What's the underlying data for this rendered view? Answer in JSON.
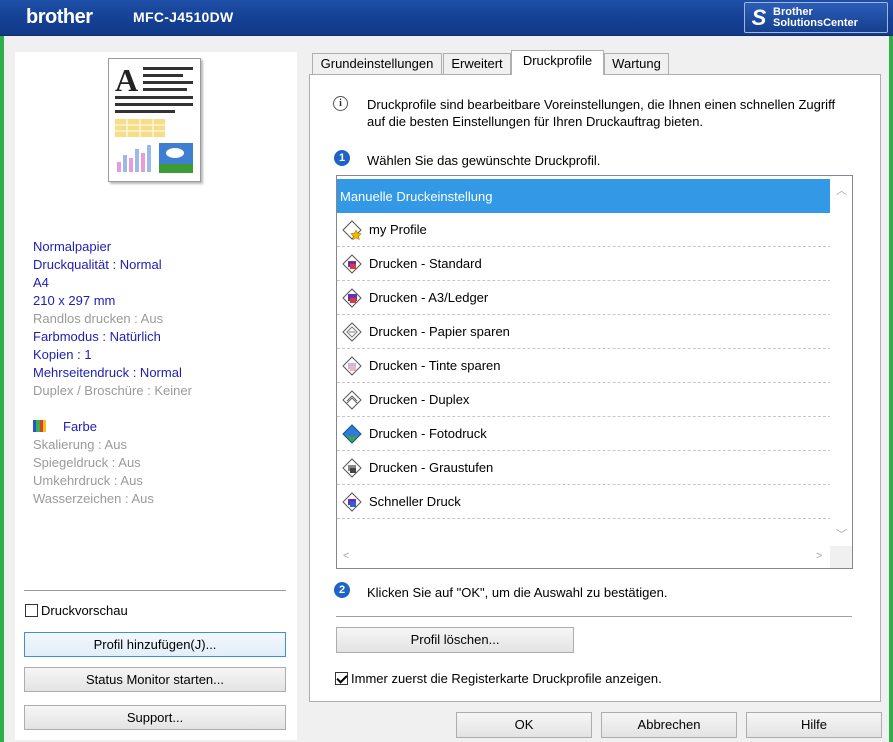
{
  "titlebar": {
    "brand": "brother",
    "model": "MFC-J4510DW",
    "solutions_line1": "Brother",
    "solutions_line2": "SolutionsCenter"
  },
  "summary": {
    "lines_on": [
      "Normalpapier",
      "Druckqualität : Normal",
      "A4",
      "210 x 297 mm"
    ],
    "randlos": "Randlos drucken : Aus",
    "farbmodus": "Farbmodus : Natürlich",
    "kopien": "Kopien : 1",
    "mehrseiten": "Mehrseitendruck : Normal",
    "duplex": "Duplex / Broschüre : Keiner",
    "farbe": "Farbe",
    "skalierung": "Skalierung : Aus",
    "spiegel": "Spiegeldruck : Aus",
    "umkehr": "Umkehrdruck : Aus",
    "wasser": "Wasserzeichen : Aus"
  },
  "left": {
    "preview_checkbox": "Druckvorschau",
    "preview_checked": false,
    "add_profile": "Profil hinzufügen(J)...",
    "status_monitor": "Status Monitor starten...",
    "support": "Support..."
  },
  "tabs": [
    "Grundeinstellungen",
    "Erweitert",
    "Druckprofile",
    "Wartung"
  ],
  "active_tab": "Druckprofile",
  "main": {
    "info_text_1": "Druckprofile sind bearbeitbare Voreinstellungen, die Ihnen einen schnellen Zugriff",
    "info_text_2": "auf die besten Einstellungen für Ihren Druckauftrag bieten.",
    "step1_num": "1",
    "step1": "Wählen Sie das gewünschte Druckprofil.",
    "profiles": [
      {
        "label": "Manuelle Druckeinstellung",
        "icon": "none",
        "selected": true
      },
      {
        "label": "my Profile",
        "icon": "star-profile-icon",
        "selected": false
      },
      {
        "label": "Drucken - Standard",
        "icon": "printer-profile-icon",
        "selected": false
      },
      {
        "label": "Drucken - A3/Ledger",
        "icon": "printer-profile-icon",
        "selected": false
      },
      {
        "label": "Drucken - Papier sparen",
        "icon": "paper-save-icon",
        "selected": false
      },
      {
        "label": "Drucken - Tinte sparen",
        "icon": "ink-save-icon",
        "selected": false
      },
      {
        "label": "Drucken - Duplex",
        "icon": "duplex-icon",
        "selected": false
      },
      {
        "label": "Drucken - Fotodruck",
        "icon": "photo-icon",
        "selected": false
      },
      {
        "label": "Drucken - Graustufen",
        "icon": "grayscale-icon",
        "selected": false
      },
      {
        "label": "Schneller Druck",
        "icon": "printer-profile-icon",
        "selected": false
      }
    ],
    "step2_num": "2",
    "step2": "Klicken Sie auf \"OK\", um die Auswahl zu bestätigen.",
    "delete_profile": "Profil löschen...",
    "always_show": "Immer zuerst die Registerkarte Druckprofile anzeigen.",
    "always_show_checked": true
  },
  "footer": {
    "ok": "OK",
    "cancel": "Abbrechen",
    "help": "Hilfe"
  },
  "colors": {
    "title_blue": "#143f93",
    "frame_green": "#2fae4a",
    "selection": "#3399e7",
    "summary_on": "#1d1db5",
    "summary_off": "#9a9a9a"
  }
}
